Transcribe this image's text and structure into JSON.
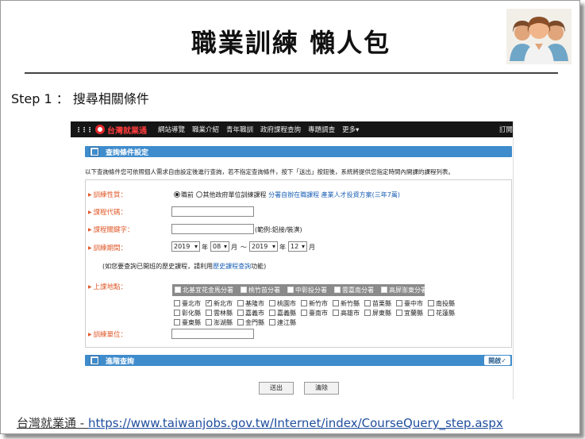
{
  "slide": {
    "title": "職業訓練 懶人包",
    "step": "Step 1 ： 搜尋相關條件",
    "footer_source": "台灣就業通 - ",
    "footer_url": "https://www.taiwanjobs.gov.tw/Internet/index/CourseQuery_step.aspx"
  },
  "site": {
    "brand": "台灣就業通",
    "nav": [
      "網站導覽",
      "職業介紹",
      "青年職訓",
      "政府課程查詢",
      "專題調查",
      "更多▾"
    ],
    "nav_right": "訂閱",
    "section_title": "查詢條件設定",
    "intro": "以下查詢條件您可依照個人需求自由設定後進行查詢，若不指定查詢條件，按下「送出」按鈕後，系統將提供您指定時間內開課的課程列表。",
    "fields": {
      "training_type_label": "訓練性質：",
      "radio_current": "職前",
      "radio_other": "其他政府單位訓練課程",
      "links": "分署自辦在職課程 產業人才投資方案(三年7萬)",
      "course_code_label": "課程代碼：",
      "keyword_label": "課程關鍵字：",
      "keyword_hint": "(範例:鋁接/裝潢)",
      "period_label": "訓練期間：",
      "start_year": "2019",
      "start_month": "08",
      "end_year": "2019",
      "end_month": "12",
      "unit_year": "年",
      "unit_month": "月",
      "range_sep": "～",
      "history_prefix": "(如您要查詢已開班的歷史課程，請利用",
      "history_link": "歷史課程查詢",
      "history_suffix": "功能)",
      "location_label": "上課地點：",
      "training_unit_label": "訓練單位："
    },
    "regions": [
      "北基宜花金馬分署",
      "桃竹苗分署",
      "中彰投分署",
      "雲嘉南分署",
      "高屏澎東分署"
    ],
    "city_rows": [
      [
        {
          "name": "臺北市",
          "checked": false
        },
        {
          "name": "新北市",
          "checked": true
        },
        {
          "name": "基隆市",
          "checked": false
        },
        {
          "name": "桃園市",
          "checked": false
        },
        {
          "name": "新竹市",
          "checked": false
        },
        {
          "name": "新竹縣",
          "checked": false
        },
        {
          "name": "苗栗縣",
          "checked": false
        },
        {
          "name": "臺中市",
          "checked": false
        },
        {
          "name": "南投縣",
          "checked": false
        }
      ],
      [
        {
          "name": "彰化縣",
          "checked": false
        },
        {
          "name": "雲林縣",
          "checked": false
        },
        {
          "name": "嘉義市",
          "checked": false
        },
        {
          "name": "嘉義縣",
          "checked": false
        },
        {
          "name": "臺南市",
          "checked": false
        },
        {
          "name": "高雄市",
          "checked": false
        },
        {
          "name": "屏東縣",
          "checked": false
        },
        {
          "name": "宜蘭縣",
          "checked": false
        },
        {
          "name": "花蓮縣",
          "checked": false
        }
      ],
      [
        {
          "name": "臺東縣",
          "checked": false
        },
        {
          "name": "澎湖縣",
          "checked": false
        },
        {
          "name": "金門縣",
          "checked": false
        },
        {
          "name": "連江縣",
          "checked": false
        }
      ]
    ],
    "advanced_title": "進階查詢",
    "advanced_toggle": "開啟✓",
    "submit": "送出",
    "clear": "清除"
  }
}
